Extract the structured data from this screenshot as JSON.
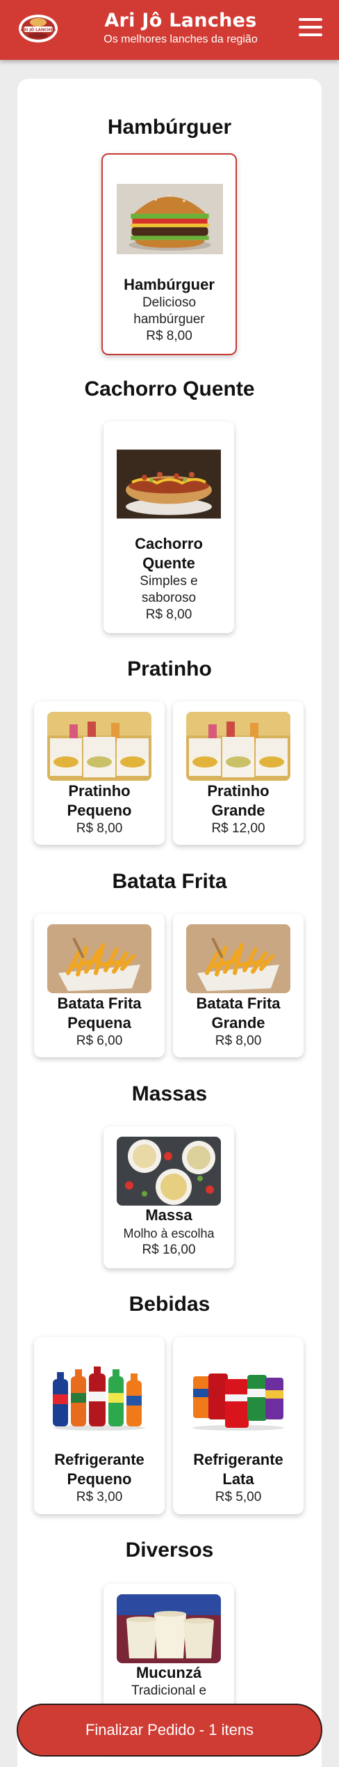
{
  "header": {
    "logo_text": "ARI JÔ LANCHES",
    "title": "Ari Jô Lanches",
    "subtitle": "Os melhores lanches da região"
  },
  "sections": [
    {
      "title": "Hambúrguer",
      "items": [
        {
          "name": "Hambúrguer",
          "description": "Delicioso hambúrguer",
          "price": "R$ 8,00",
          "image": "burger-image"
        }
      ]
    },
    {
      "title": "Cachorro Quente",
      "items": [
        {
          "name": "Cachorro Quente",
          "description": "Simples e saboroso",
          "price": "R$ 8,00",
          "image": "hotdog-image"
        }
      ]
    },
    {
      "title": "Pratinho",
      "items": [
        {
          "name": "Pratinho Pequeno",
          "price": "R$ 8,00",
          "image": "plates-image"
        },
        {
          "name": "Pratinho Grande",
          "price": "R$ 12,00",
          "image": "plates-image"
        }
      ]
    },
    {
      "title": "Batata Frita",
      "items": [
        {
          "name": "Batata Frita Pequena",
          "price": "R$ 6,00",
          "image": "fries-image"
        },
        {
          "name": "Batata Frita Grande",
          "price": "R$ 8,00",
          "image": "fries-image"
        }
      ]
    },
    {
      "title": "Massas",
      "items": [
        {
          "name": "Massa",
          "description": "Molho à escolha",
          "price": "R$ 16,00",
          "image": "pasta-image"
        }
      ]
    },
    {
      "title": "Bebidas",
      "items": [
        {
          "name": "Refrigerante Pequeno",
          "price": "R$ 3,00",
          "image": "soda-bottles-image"
        },
        {
          "name": "Refrigerante Lata",
          "price": "R$ 5,00",
          "image": "soda-cans-image"
        }
      ]
    },
    {
      "title": "Diversos",
      "items": [
        {
          "name": "Mucunzá",
          "description": "Tradicional e",
          "image": "mucunza-image"
        }
      ]
    }
  ],
  "footer": {
    "finish_label": "Finalizar Pedido - 1 itens"
  },
  "colors": {
    "brand_red": "#d13b33",
    "selected_border": "#c63a34"
  }
}
